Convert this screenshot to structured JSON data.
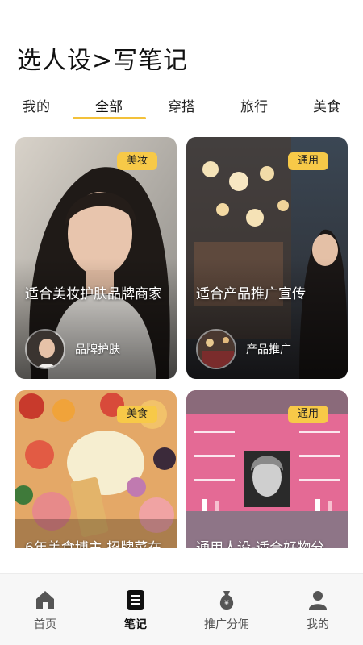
{
  "header": {
    "title": "选人设>写笔记"
  },
  "tabs": [
    {
      "label": "我的"
    },
    {
      "label": "全部",
      "active": true
    },
    {
      "label": "穿搭"
    },
    {
      "label": "旅行"
    },
    {
      "label": "美食"
    }
  ],
  "cards": [
    {
      "badge": "美妆",
      "title": "适合美妆护肤品牌商家",
      "tag": "品牌护肤"
    },
    {
      "badge": "通用",
      "title": "适合产品推广宣传",
      "tag": "产品推广"
    },
    {
      "badge": "美食",
      "title": "6年美食博主 招牌菜在"
    },
    {
      "badge": "通用",
      "title": "通用人设-适合好物分"
    }
  ],
  "nav": [
    {
      "label": "首页",
      "icon": "home-icon"
    },
    {
      "label": "笔记",
      "icon": "note-icon",
      "active": true
    },
    {
      "label": "推广分佣",
      "icon": "money-bag-icon"
    },
    {
      "label": "我的",
      "icon": "person-icon"
    }
  ],
  "colors": {
    "accent": "#f3c13a",
    "badge": "#f7c948"
  }
}
